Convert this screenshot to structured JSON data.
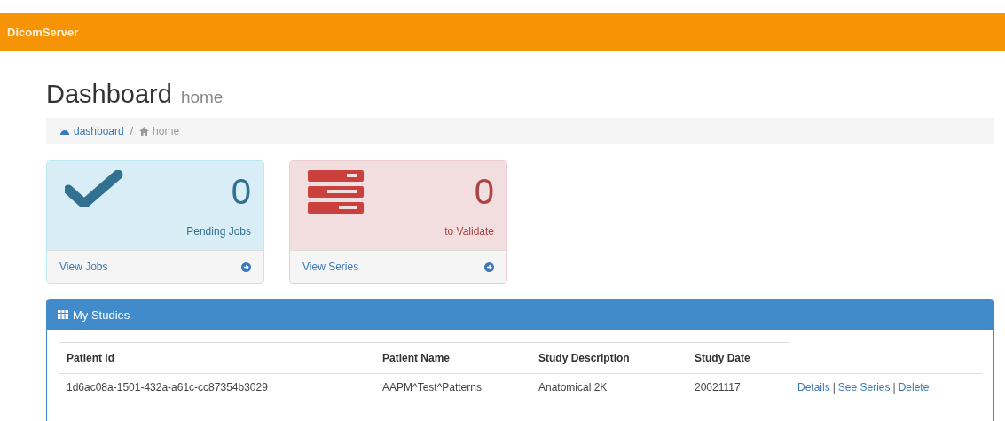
{
  "navbar": {
    "brand": "DicomServer"
  },
  "page_header": {
    "title": "Dashboard",
    "subtitle": "home"
  },
  "breadcrumb": [
    {
      "kind": "dashboard",
      "label": "dashboard",
      "active": false
    },
    {
      "kind": "divider",
      "label": "/"
    },
    {
      "kind": "home",
      "label": "home",
      "active": true
    }
  ],
  "cards": [
    {
      "kind": "info",
      "count": "0",
      "label": "Pending Jobs",
      "footer": "View Jobs"
    },
    {
      "kind": "danger",
      "count": "0",
      "label": "to Validate",
      "footer": "View Series"
    }
  ],
  "panel": {
    "title": "My Studies",
    "table": {
      "columns": [
        "Patient Id",
        "Patient Name",
        "Study Description",
        "Study Date"
      ],
      "rows": [
        {
          "cells": [
            "1d6ac08a-1501-432a-a61c-cc87354b3029",
            "AAPM^Test^Patterns",
            "Anatomical 2K",
            "20021117"
          ],
          "actions": [
            {
              "kind": "link",
              "text": "Details"
            },
            {
              "kind": "sep",
              "text": "|"
            },
            {
              "kind": "link",
              "text": "See Series"
            },
            {
              "kind": "sep",
              "text": "|"
            },
            {
              "kind": "link",
              "text": "Delete"
            }
          ]
        }
      ]
    }
  }
}
